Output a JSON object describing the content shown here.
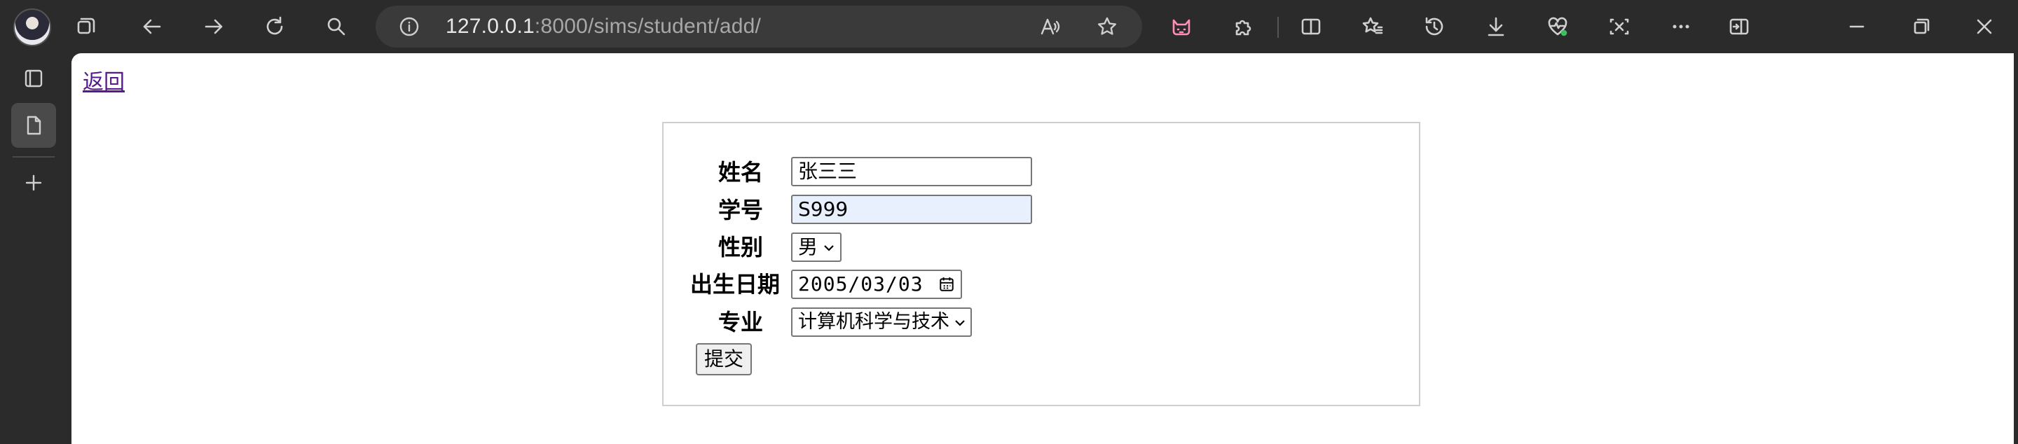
{
  "browser": {
    "url_host": "127.0.0.1",
    "url_path": ":8000/sims/student/add/"
  },
  "page": {
    "back_link": "返回",
    "form": {
      "name_label": "姓名",
      "name_value": "张三三",
      "id_label": "学号",
      "id_value": "S999",
      "gender_label": "性别",
      "gender_value": "男",
      "birth_label": "出生日期",
      "birth_value": "2005/03/03",
      "major_label": "专业",
      "major_value": "计算机科学与技术",
      "submit_label": "提交"
    }
  },
  "icons": {
    "toolbar": [
      "profile-avatar",
      "workspaces-icon",
      "back-icon",
      "forward-icon",
      "refresh-icon",
      "search-icon",
      "info-icon",
      "read-aloud-icon",
      "favorite-star-icon",
      "extension-cat-icon",
      "extensions-icon",
      "split-screen-icon",
      "favorites-icon",
      "history-icon",
      "downloads-icon",
      "browser-health-icon",
      "screenshot-icon",
      "more-icon",
      "sidebar-toggle-icon",
      "minimize-icon",
      "restore-icon",
      "close-icon"
    ],
    "sidebar": [
      "tab-actions-icon",
      "page-tab-icon",
      "new-tab-icon"
    ]
  }
}
